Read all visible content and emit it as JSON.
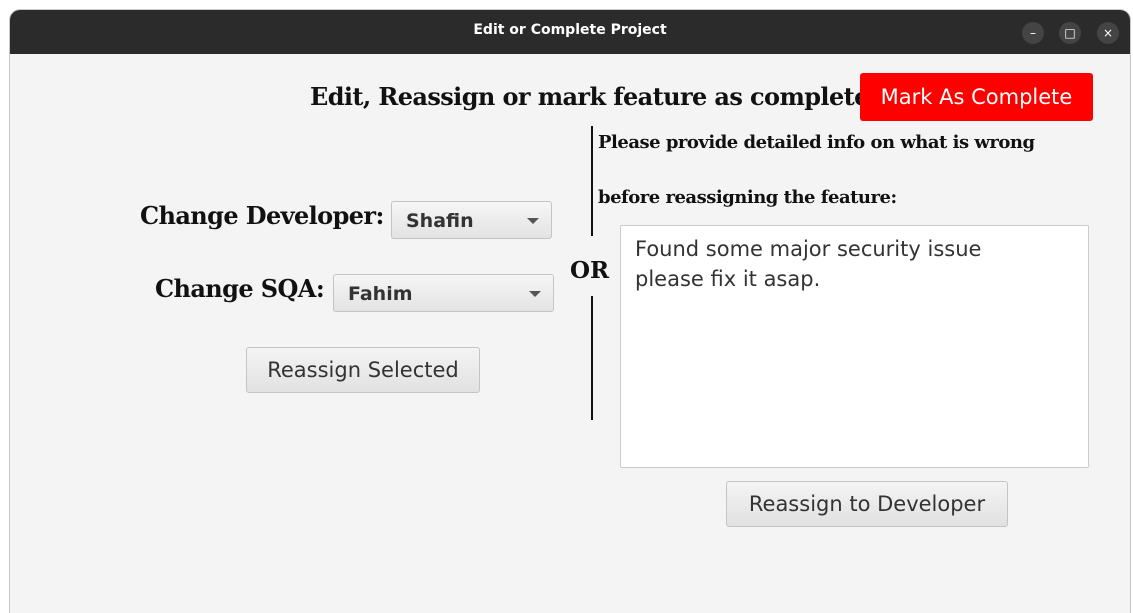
{
  "window": {
    "title": "Edit or Complete Project",
    "controls": {
      "minimize_icon": "–",
      "maximize_icon": "□",
      "close_icon": "×"
    }
  },
  "header": {
    "heading": "Edit, Reassign or mark feature as complete",
    "mark_complete_label": "Mark As Complete"
  },
  "left_panel": {
    "change_developer_label": "Change Developer:",
    "developer_selected": "Shafin",
    "change_sqa_label": "Change SQA:",
    "sqa_selected": "Fahim",
    "reassign_selected_label": "Reassign Selected"
  },
  "divider": {
    "or_text": "OR"
  },
  "right_panel": {
    "instruction_line1": "Please provide detailed info on what is wrong",
    "instruction_line2": "before reassigning the feature:",
    "feedback_value": "Found some major security issue\nplease fix it asap.",
    "reassign_developer_label": "Reassign to Developer"
  },
  "colors": {
    "titlebar": "#2b2b2b",
    "window_bg": "#f4f4f4",
    "complete_button": "#ff0000"
  }
}
